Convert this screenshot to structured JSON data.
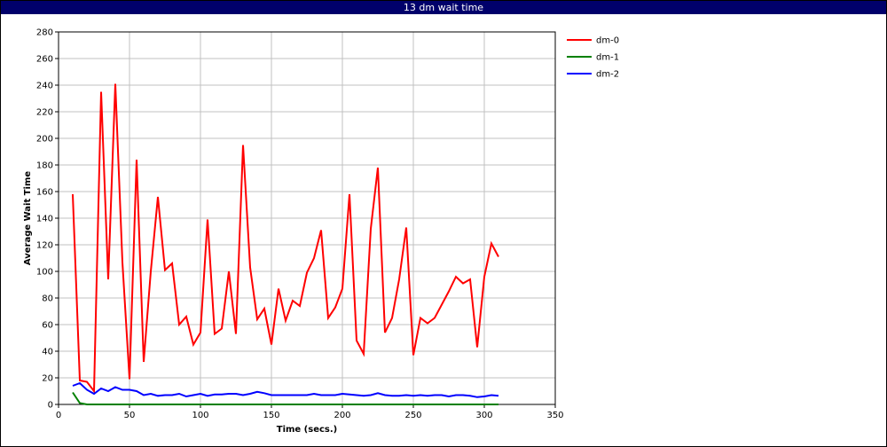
{
  "title": "13 dm wait time",
  "chart_data": {
    "type": "line",
    "title": "13 dm wait time",
    "xlabel": "Time (secs.)",
    "ylabel": "Average Wait Time",
    "xlim": [
      0,
      350
    ],
    "ylim": [
      0,
      280
    ],
    "xticks": [
      0,
      50,
      100,
      150,
      200,
      250,
      300,
      350
    ],
    "yticks": [
      0,
      20,
      40,
      60,
      80,
      100,
      120,
      140,
      160,
      180,
      200,
      220,
      240,
      260,
      280
    ],
    "grid": true,
    "legend_position": "right",
    "series": [
      {
        "name": "dm-0",
        "color": "#ff0000",
        "x": [
          10,
          15,
          20,
          25,
          30,
          35,
          40,
          45,
          50,
          55,
          60,
          65,
          70,
          75,
          80,
          85,
          90,
          95,
          100,
          105,
          110,
          115,
          120,
          125,
          130,
          135,
          140,
          145,
          150,
          155,
          160,
          165,
          170,
          175,
          180,
          185,
          190,
          195,
          200,
          205,
          210,
          215,
          220,
          225,
          230,
          235,
          240,
          245,
          250,
          255,
          260,
          265,
          270,
          275,
          280,
          285,
          290,
          295,
          300,
          305,
          310
        ],
        "values": [
          158,
          18,
          17,
          10,
          235,
          94,
          241,
          107,
          19,
          184,
          32,
          100,
          156,
          101,
          106,
          60,
          66,
          45,
          54,
          139,
          53,
          57,
          100,
          53,
          195,
          103,
          64,
          72,
          45,
          87,
          63,
          78,
          74,
          99,
          110,
          131,
          65,
          73,
          87,
          158,
          48,
          38,
          132,
          178,
          54,
          65,
          94,
          133,
          37,
          65,
          61,
          65,
          75,
          85,
          96,
          91,
          94,
          43,
          96,
          121,
          111
        ]
      },
      {
        "name": "dm-1",
        "color": "#008000",
        "x": [
          10,
          15,
          20,
          25,
          30,
          35,
          40,
          45,
          50,
          55,
          60,
          65,
          70,
          75,
          80,
          85,
          90,
          95,
          100,
          105,
          110,
          115,
          120,
          125,
          130,
          135,
          140,
          145,
          150,
          155,
          160,
          165,
          170,
          175,
          180,
          185,
          190,
          195,
          200,
          205,
          210,
          215,
          220,
          225,
          230,
          235,
          240,
          245,
          250,
          255,
          260,
          265,
          270,
          275,
          280,
          285,
          290,
          295,
          300,
          305,
          310
        ],
        "values": [
          9,
          1,
          0,
          0,
          0,
          0,
          0,
          0,
          0,
          0,
          0,
          0,
          0,
          0,
          0,
          0,
          0,
          0,
          0,
          0,
          0,
          0,
          0,
          0,
          0,
          0,
          0,
          0,
          0,
          0,
          0,
          0,
          0,
          0,
          0,
          0,
          0,
          0,
          0,
          0,
          0,
          0,
          0,
          0,
          0,
          0,
          0,
          0,
          0,
          0,
          0,
          0,
          0,
          0,
          0,
          0,
          0,
          0,
          0,
          0,
          0
        ]
      },
      {
        "name": "dm-2",
        "color": "#0000ff",
        "x": [
          10,
          15,
          20,
          25,
          30,
          35,
          40,
          45,
          50,
          55,
          60,
          65,
          70,
          75,
          80,
          85,
          90,
          95,
          100,
          105,
          110,
          115,
          120,
          125,
          130,
          135,
          140,
          145,
          150,
          155,
          160,
          165,
          170,
          175,
          180,
          185,
          190,
          195,
          200,
          205,
          210,
          215,
          220,
          225,
          230,
          235,
          240,
          245,
          250,
          255,
          260,
          265,
          270,
          275,
          280,
          285,
          290,
          295,
          300,
          305,
          310
        ],
        "values": [
          14,
          16,
          11,
          8,
          12,
          10,
          13,
          11,
          11,
          10,
          7,
          8,
          6.5,
          7,
          7,
          8,
          6,
          7,
          8,
          6.5,
          7.5,
          7.5,
          8,
          8,
          7,
          8,
          9.5,
          8.5,
          7,
          7,
          7,
          7,
          7,
          7,
          8,
          7,
          7,
          7,
          8,
          7.5,
          7,
          6.5,
          7,
          8.5,
          7,
          6.5,
          6.5,
          7,
          6.5,
          7,
          6.5,
          7,
          7,
          6,
          7,
          7,
          6.5,
          5.5,
          6,
          7,
          6.5
        ]
      }
    ]
  }
}
